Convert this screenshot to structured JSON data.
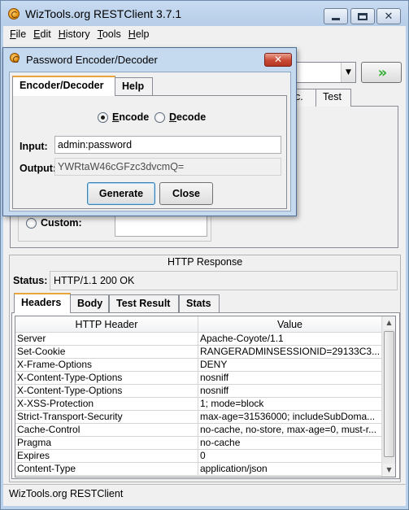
{
  "window": {
    "title": "WizTools.org RESTClient 3.7.1",
    "caption_buttons": {
      "minimize": "minimize-icon",
      "maximize": "maximize-icon",
      "close": "✕"
    }
  },
  "menu": [
    "File",
    "Edit",
    "History",
    "Tools",
    "Help"
  ],
  "request": {
    "go_icon": "»",
    "dropdown_icon": "▼",
    "tabs": {
      "etc": "c.",
      "test": "Test"
    },
    "custom_label": "Custom:"
  },
  "dialog": {
    "title": "Password Encoder/Decoder",
    "close_glyph": "✕",
    "tabs": [
      "Encoder/Decoder",
      "Help"
    ],
    "encode_label": "Encode",
    "decode_label": "Decode",
    "mode_selected": "Encode",
    "input_label": "Input:",
    "input_value": "admin:password",
    "output_label": "Output:",
    "output_value": "YWRtaW46cGFzc3dvcmQ=",
    "generate_label": "Generate",
    "close_label": "Close"
  },
  "response": {
    "section_title": "HTTP Response",
    "status_label": "Status:",
    "status_value": "HTTP/1.1 200 OK",
    "tabs": [
      "Headers",
      "Body",
      "Test Result",
      "Stats"
    ],
    "active_tab": "Headers",
    "columns": [
      "HTTP Header",
      "Value"
    ],
    "rows": [
      [
        "Server",
        "Apache-Coyote/1.1"
      ],
      [
        "Set-Cookie",
        "RANGERADMINSESSIONID=29133C3..."
      ],
      [
        "X-Frame-Options",
        "DENY"
      ],
      [
        "X-Content-Type-Options",
        "nosniff"
      ],
      [
        "X-Content-Type-Options",
        "nosniff"
      ],
      [
        "X-XSS-Protection",
        "1; mode=block"
      ],
      [
        "Strict-Transport-Security",
        "max-age=31536000; includeSubDoma..."
      ],
      [
        "Cache-Control",
        "no-cache, no-store, max-age=0, must-r..."
      ],
      [
        "Pragma",
        "no-cache"
      ],
      [
        "Expires",
        "0"
      ],
      [
        "Content-Type",
        "application/json"
      ]
    ]
  },
  "statusbar": {
    "text": "WizTools.org RESTClient"
  },
  "colors": {
    "title_bar": "#b9d1ea",
    "close_button": "#c94a33",
    "go_arrows": "#2fae2f",
    "active_tab_accent": "#e8a53a"
  }
}
